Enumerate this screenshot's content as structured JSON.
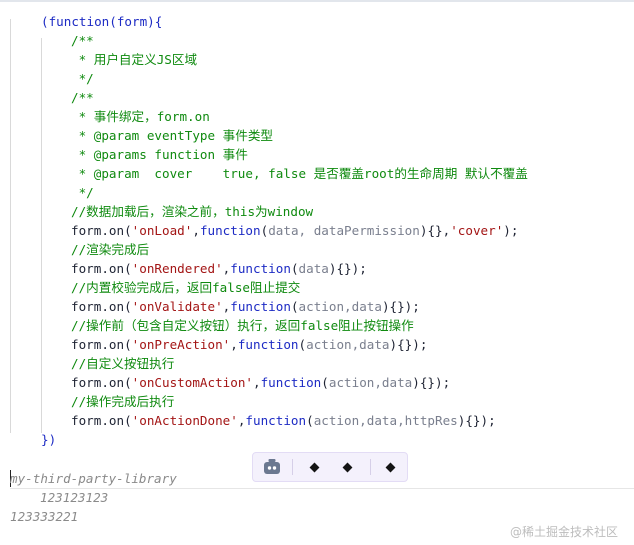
{
  "code_lines": [
    {
      "segments": [
        {
          "t": "(function(form){",
          "c": "kw"
        }
      ]
    },
    {
      "segments": [
        {
          "t": "/**",
          "c": "cmt"
        }
      ]
    },
    {
      "segments": [
        {
          "t": " * 用户自定义JS区域",
          "c": "cmt"
        }
      ]
    },
    {
      "segments": [
        {
          "t": " */",
          "c": "cmt"
        }
      ]
    },
    {
      "segments": [
        {
          "t": "/**",
          "c": "cmt"
        }
      ]
    },
    {
      "segments": [
        {
          "t": " * 事件绑定，form.on",
          "c": "cmt"
        }
      ]
    },
    {
      "segments": [
        {
          "t": " * @param eventType 事件类型",
          "c": "cmt"
        }
      ]
    },
    {
      "segments": [
        {
          "t": " * @params function 事件",
          "c": "cmt"
        }
      ]
    },
    {
      "segments": [
        {
          "t": " * @param  cover    true, false 是否覆盖root的生命周期 默认不覆盖",
          "c": "cmt"
        }
      ]
    },
    {
      "segments": [
        {
          "t": " */",
          "c": "cmt"
        }
      ]
    },
    {
      "segments": [
        {
          "t": "//数据加载后，渲染之前，this为window",
          "c": "cmt"
        }
      ]
    },
    {
      "segments": [
        {
          "t": "form.on(",
          "c": "dark"
        },
        {
          "t": "'onLoad'",
          "c": "str"
        },
        {
          "t": ",",
          "c": "dark"
        },
        {
          "t": "function",
          "c": "kw"
        },
        {
          "t": "(",
          "c": "dark"
        },
        {
          "t": "data, dataPermission",
          "c": "var"
        },
        {
          "t": "){},",
          "c": "dark"
        },
        {
          "t": "'cover'",
          "c": "str"
        },
        {
          "t": ");",
          "c": "dark"
        }
      ]
    },
    {
      "segments": [
        {
          "t": "//渲染完成后",
          "c": "cmt"
        }
      ]
    },
    {
      "segments": [
        {
          "t": "form.on(",
          "c": "dark"
        },
        {
          "t": "'onRendered'",
          "c": "str"
        },
        {
          "t": ",",
          "c": "dark"
        },
        {
          "t": "function",
          "c": "kw"
        },
        {
          "t": "(",
          "c": "dark"
        },
        {
          "t": "data",
          "c": "var"
        },
        {
          "t": "){});",
          "c": "dark"
        }
      ]
    },
    {
      "segments": [
        {
          "t": "//内置校验完成后，返回false阻止提交",
          "c": "cmt"
        }
      ]
    },
    {
      "segments": [
        {
          "t": "form.on(",
          "c": "dark"
        },
        {
          "t": "'onValidate'",
          "c": "str"
        },
        {
          "t": ",",
          "c": "dark"
        },
        {
          "t": "function",
          "c": "kw"
        },
        {
          "t": "(",
          "c": "dark"
        },
        {
          "t": "action,data",
          "c": "var"
        },
        {
          "t": "){});",
          "c": "dark"
        }
      ]
    },
    {
      "segments": [
        {
          "t": "//操作前（包含自定义按钮）执行，返回false阻止按钮操作",
          "c": "cmt"
        }
      ]
    },
    {
      "segments": [
        {
          "t": "form.on(",
          "c": "dark"
        },
        {
          "t": "'onPreAction'",
          "c": "str"
        },
        {
          "t": ",",
          "c": "dark"
        },
        {
          "t": "function",
          "c": "kw"
        },
        {
          "t": "(",
          "c": "dark"
        },
        {
          "t": "action,data",
          "c": "var"
        },
        {
          "t": "){});",
          "c": "dark"
        }
      ]
    },
    {
      "segments": [
        {
          "t": "//自定义按钮执行",
          "c": "cmt"
        }
      ]
    },
    {
      "segments": [
        {
          "t": "form.on(",
          "c": "dark"
        },
        {
          "t": "'onCustomAction'",
          "c": "str"
        },
        {
          "t": ",",
          "c": "dark"
        },
        {
          "t": "function",
          "c": "kw"
        },
        {
          "t": "(",
          "c": "dark"
        },
        {
          "t": "action,data",
          "c": "var"
        },
        {
          "t": "){});",
          "c": "dark"
        }
      ]
    },
    {
      "segments": [
        {
          "t": "//操作完成后执行",
          "c": "cmt"
        }
      ]
    },
    {
      "segments": [
        {
          "t": "form.on(",
          "c": "dark"
        },
        {
          "t": "'onActionDone'",
          "c": "str"
        },
        {
          "t": ",",
          "c": "dark"
        },
        {
          "t": "function",
          "c": "kw"
        },
        {
          "t": "(",
          "c": "dark"
        },
        {
          "t": "action,data,httpRes",
          "c": "var"
        },
        {
          "t": "){});",
          "c": "dark"
        }
      ]
    },
    {
      "segments": [
        {
          "t": "})",
          "c": "kw"
        }
      ]
    }
  ],
  "toolbar": {
    "bot_icon": "robot-icon",
    "buttons": [
      "diamond-icon",
      "diamond-icon",
      "diamond-icon"
    ]
  },
  "text_blocks": {
    "library": "my-third-party-library",
    "line_one": "123123123",
    "line_two": "123333221"
  },
  "watermark": "@稀土掘金技术社区",
  "colors": {
    "keyword": "#1d2bc4",
    "string": "#a31515",
    "comment": "#0f8a0f",
    "param": "#7a7f8e",
    "toolbar_bg": "#f4f1fc"
  }
}
